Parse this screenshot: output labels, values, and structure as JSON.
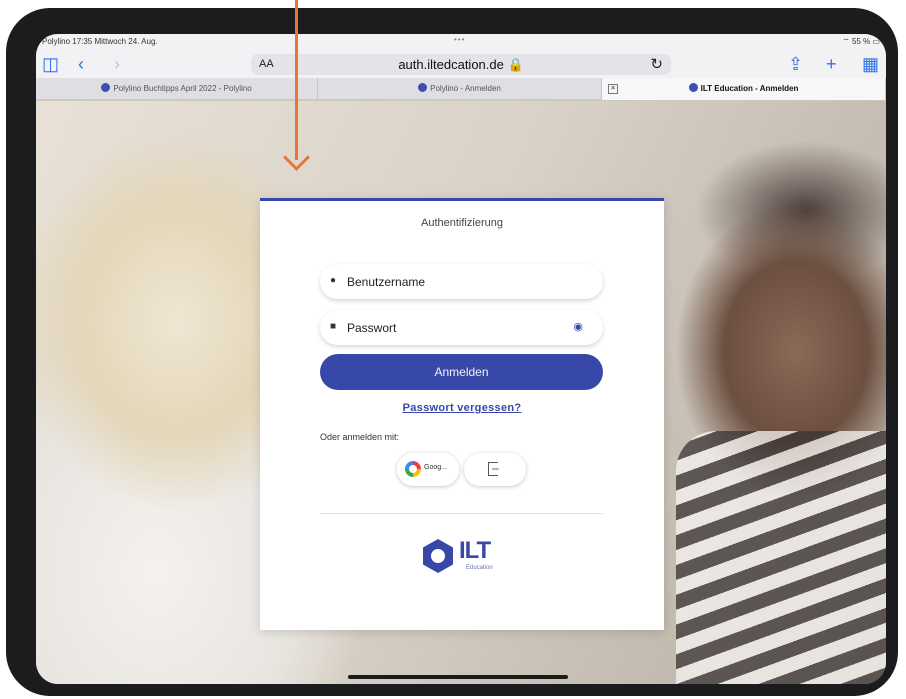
{
  "statusbar": {
    "left": "Polylino 17:35 Mittwoch 24. Aug.",
    "dots": "•••",
    "right": "⌔ 55 % ▭"
  },
  "toolbar": {
    "aa": "AA",
    "url": "auth.iltedcation.de 🔒",
    "reload": "↻"
  },
  "tabs": [
    {
      "label": "Polylino Buchtipps April 2022 - Polylino"
    },
    {
      "label": "Polylino - Anmelden"
    },
    {
      "label": "ILT Education - Anmelden"
    }
  ],
  "login": {
    "title": "Authentifizierung",
    "username_value": "Benutzername",
    "password_value": "Passwort",
    "submit_label": "Anmelden",
    "forgot_label": "Passwort vergessen?",
    "alt_label": "Oder anmelden mit:",
    "google_label": "Goog..."
  },
  "logo": {
    "name": "ILT",
    "sub": "Education"
  },
  "colors": {
    "accent": "#3748a8",
    "annotation": "#e8743d"
  }
}
